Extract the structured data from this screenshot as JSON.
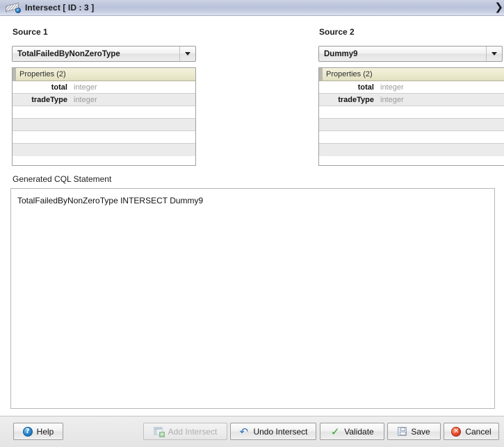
{
  "window": {
    "title": "Intersect [ ID : 3 ]",
    "title_icon": "intersect-diagonal-icon",
    "expand_chevron": "❯"
  },
  "sources": [
    {
      "label": "Source 1",
      "combo_value": "TotalFailedByNonZeroType",
      "combo_arrow_icon": "chevron-down-icon",
      "properties_header": "Properties (2)",
      "properties": [
        {
          "name": "total",
          "type": "integer"
        },
        {
          "name": "tradeType",
          "type": "integer"
        },
        {
          "name": "",
          "type": ""
        },
        {
          "name": "",
          "type": ""
        },
        {
          "name": "",
          "type": ""
        },
        {
          "name": "",
          "type": ""
        }
      ]
    },
    {
      "label": "Source 2",
      "combo_value": "Dummy9",
      "combo_arrow_icon": "chevron-down-icon",
      "properties_header": "Properties (2)",
      "properties": [
        {
          "name": "total",
          "type": "integer"
        },
        {
          "name": "tradeType",
          "type": "integer"
        },
        {
          "name": "",
          "type": ""
        },
        {
          "name": "",
          "type": ""
        },
        {
          "name": "",
          "type": ""
        },
        {
          "name": "",
          "type": ""
        }
      ]
    }
  ],
  "cql": {
    "label": "Generated CQL Statement",
    "statement": "TotalFailedByNonZeroType INTERSECT Dummy9"
  },
  "footer": {
    "help": {
      "label": "Help",
      "icon": "question-mark-icon"
    },
    "add_intersect": {
      "label": "Add Intersect",
      "icon": "table-plus-icon",
      "disabled": true
    },
    "undo_intersect": {
      "label": "Undo Intersect",
      "icon": "undo-arrow-icon"
    },
    "validate": {
      "label": "Validate",
      "icon": "green-check-icon"
    },
    "save": {
      "label": "Save",
      "icon": "floppy-disk-icon"
    },
    "cancel": {
      "label": "Cancel",
      "icon": "red-x-circle-icon"
    }
  },
  "colors": {
    "titlebar": "#c2cade",
    "table_header": "#eceace",
    "accent_blue": "#2a86cf",
    "accent_green": "#2aa22a",
    "accent_red": "#e84a2a"
  }
}
